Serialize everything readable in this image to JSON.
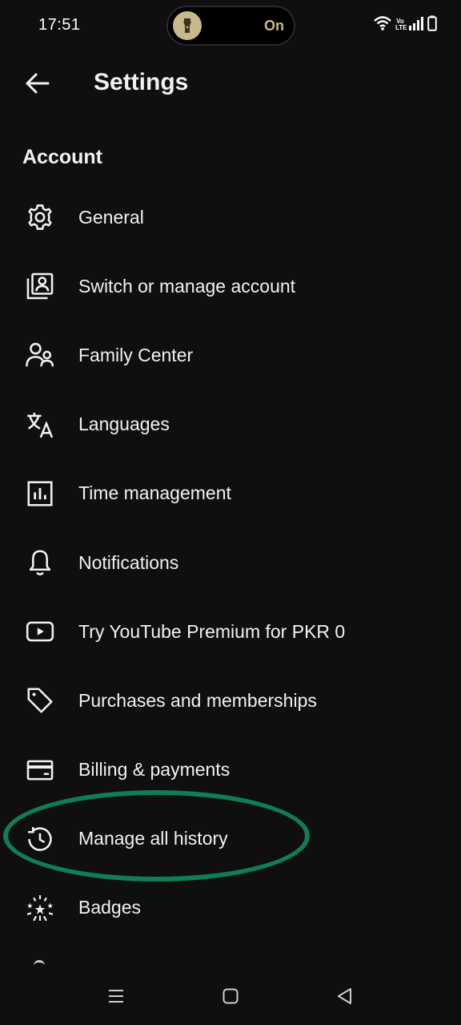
{
  "status_bar": {
    "time": "17:51",
    "torch_state": "On",
    "volte_label": "Vo LTE"
  },
  "app_bar": {
    "title": "Settings"
  },
  "section": {
    "header": "Account"
  },
  "settings_items": [
    {
      "label": "General",
      "icon": "gear-icon"
    },
    {
      "label": "Switch or manage account",
      "icon": "account-box-icon"
    },
    {
      "label": "Family Center",
      "icon": "people-icon"
    },
    {
      "label": "Languages",
      "icon": "translate-icon"
    },
    {
      "label": "Time management",
      "icon": "bar-chart-icon"
    },
    {
      "label": "Notifications",
      "icon": "bell-icon"
    },
    {
      "label": "Try YouTube Premium for PKR 0",
      "icon": "play-box-icon"
    },
    {
      "label": "Purchases and memberships",
      "icon": "tag-icon"
    },
    {
      "label": "Billing & payments",
      "icon": "credit-card-icon"
    },
    {
      "label": "Manage all history",
      "icon": "history-icon"
    },
    {
      "label": "Badges",
      "icon": "badges-icon"
    }
  ],
  "colors": {
    "background": "#0f0f0f",
    "text": "#f1f1f1",
    "highlight": "#0f7f53",
    "torch": "#c9b98a"
  }
}
